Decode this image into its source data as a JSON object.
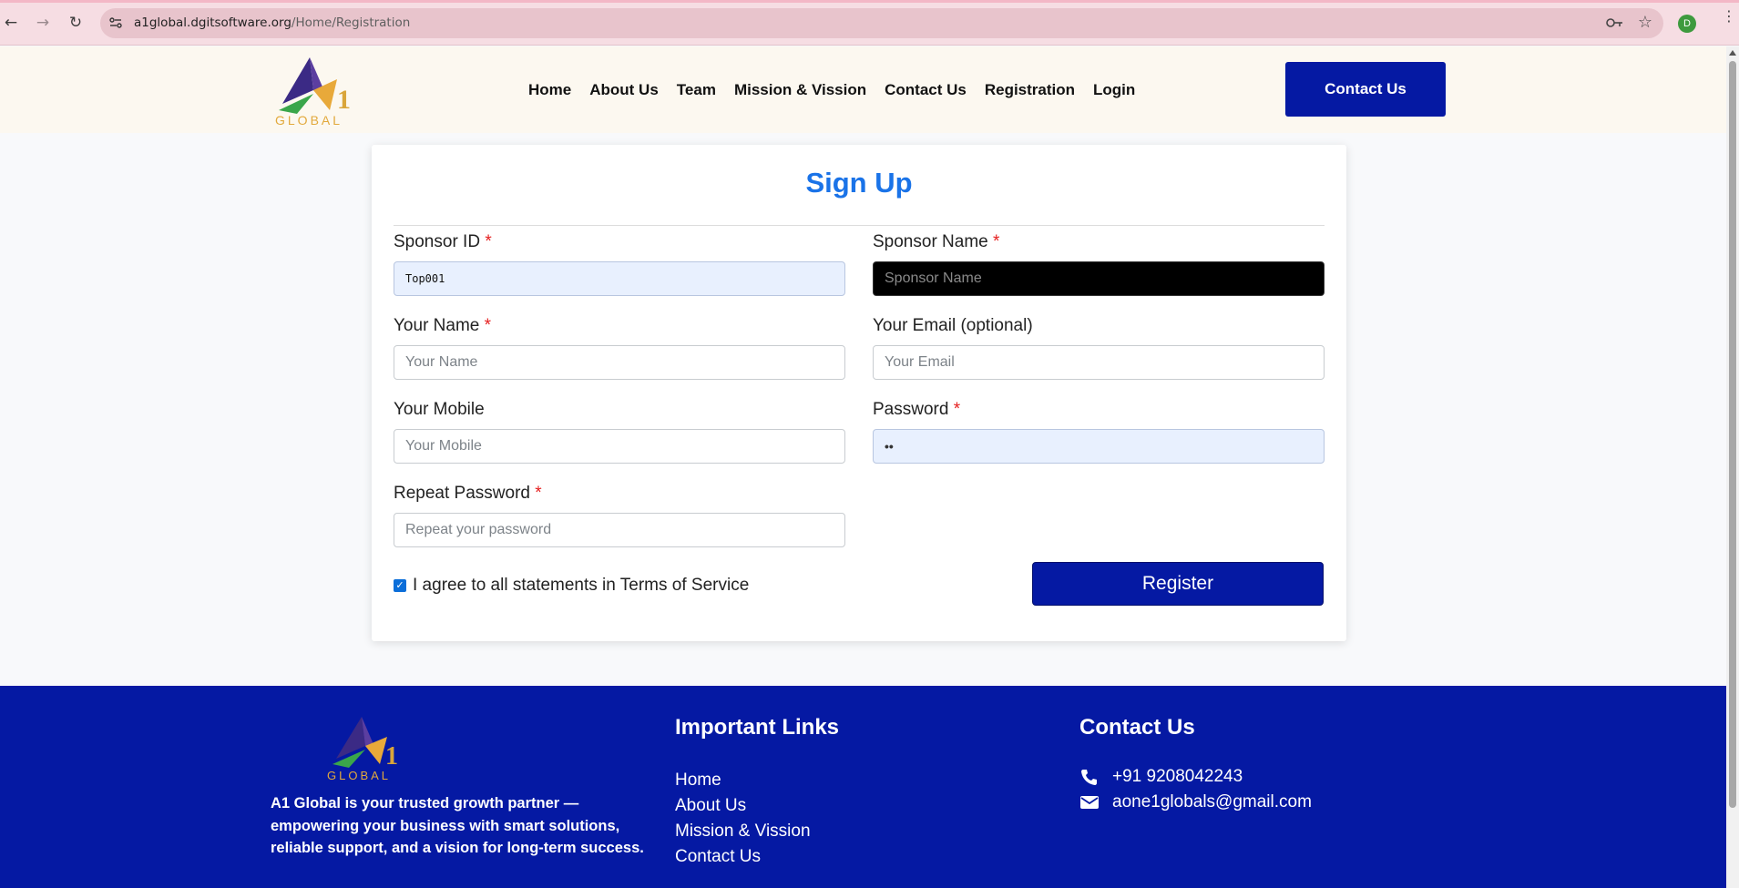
{
  "browser": {
    "url_host": "a1global.dgitsoftware.org",
    "url_path": "/Home/Registration",
    "profile_initial": "D",
    "back_icon": "←",
    "forward_icon": "→",
    "reload_icon": "↻",
    "star_icon": "☆",
    "menu_icon": "⋮"
  },
  "header": {
    "logo_text": "GLOBAL",
    "logo_digit": "1",
    "nav": [
      "Home",
      "About Us",
      "Team",
      "Mission & Vission",
      "Contact Us",
      "Registration",
      "Login"
    ],
    "contact_button": "Contact Us"
  },
  "form": {
    "title": "Sign Up",
    "sponsor_id": {
      "label": "Sponsor ID",
      "required": "*",
      "value": "Top001"
    },
    "sponsor_name": {
      "label": "Sponsor Name",
      "required": "*",
      "placeholder": "Sponsor Name"
    },
    "your_name": {
      "label": "Your Name",
      "required": "*",
      "placeholder": "Your Name"
    },
    "your_email": {
      "label": "Your Email (optional)",
      "placeholder": "Your Email"
    },
    "your_mobile": {
      "label": "Your Mobile",
      "placeholder": "Your Mobile"
    },
    "password": {
      "label": "Password",
      "required": "*",
      "value": "••"
    },
    "repeat_password": {
      "label": "Repeat Password",
      "required": "*",
      "placeholder": "Repeat your password"
    },
    "agree_text": "I agree to all statements in Terms of Service",
    "agree_checked": true,
    "checkmark": "✓",
    "register_button": "Register"
  },
  "footer": {
    "about": "A1 Global is your trusted growth partner — empowering your business with smart solutions, reliable support, and a vision for long-term success.",
    "links_heading": "Important Links",
    "links": [
      "Home",
      "About Us",
      "Mission & Vission",
      "Contact Us"
    ],
    "contact_heading": "Contact Us",
    "phone": "+91 9208042243",
    "email": "aone1globals@gmail.com"
  },
  "colors": {
    "brand_blue": "#0519a3",
    "title_blue": "#1a73e8",
    "required_red": "#e52020",
    "header_bg": "#fcf8f0"
  }
}
